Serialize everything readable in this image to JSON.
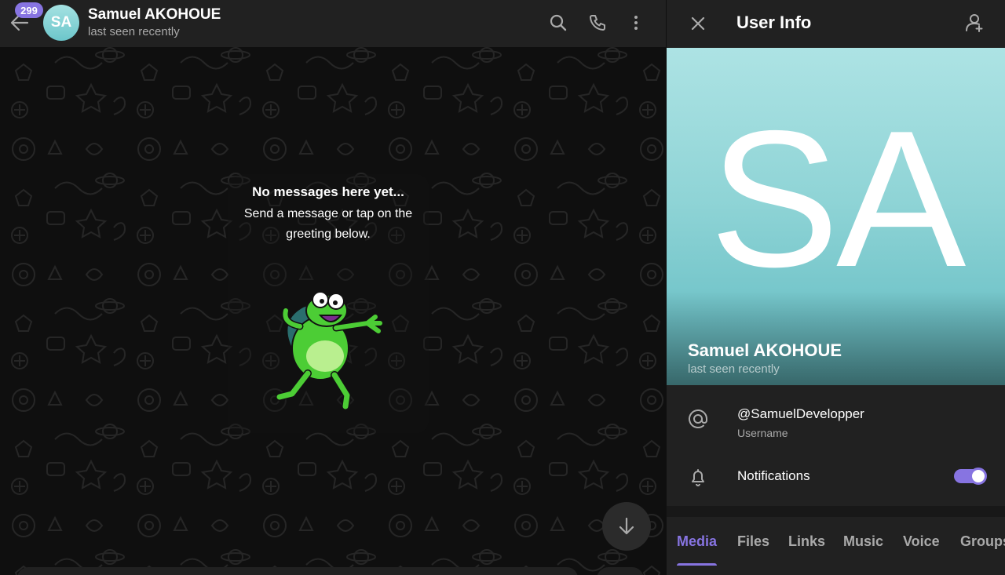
{
  "chat_header": {
    "unread_count": "299",
    "avatar_initials": "SA",
    "name": "Samuel AKOHOUE",
    "status": "last seen recently",
    "icons": [
      "back-arrow-icon",
      "search-icon",
      "phone-icon",
      "more-vertical-icon"
    ]
  },
  "empty_state": {
    "title": "No messages here yet...",
    "description": "Send a message or tap on the greeting below.",
    "sticker": "frog-greeting-sticker"
  },
  "scroll_down": {
    "icon": "arrow-down-icon"
  },
  "user_info": {
    "title": "User Info",
    "close_icon": "close-icon",
    "add_contact_icon": "add-contact-icon",
    "cover_initials": "SA",
    "name": "Samuel AKOHOUE",
    "status": "last seen recently",
    "username": "@SamuelDevelopper",
    "username_label": "Username",
    "notifications_label": "Notifications",
    "notifications_enabled": true,
    "tabs": [
      {
        "label": "Media",
        "active": true
      },
      {
        "label": "Files",
        "active": false
      },
      {
        "label": "Links",
        "active": false
      },
      {
        "label": "Music",
        "active": false
      },
      {
        "label": "Voice",
        "active": false
      },
      {
        "label": "Groups",
        "active": false
      }
    ]
  },
  "colors": {
    "accent": "#8774e1",
    "header_bg": "#212121",
    "chat_bg": "#0f0f0f",
    "avatar_gradient_top": "#a5e2e2",
    "avatar_gradient_bottom": "#6cc6cb",
    "secondary_text": "#aaaaaa"
  }
}
